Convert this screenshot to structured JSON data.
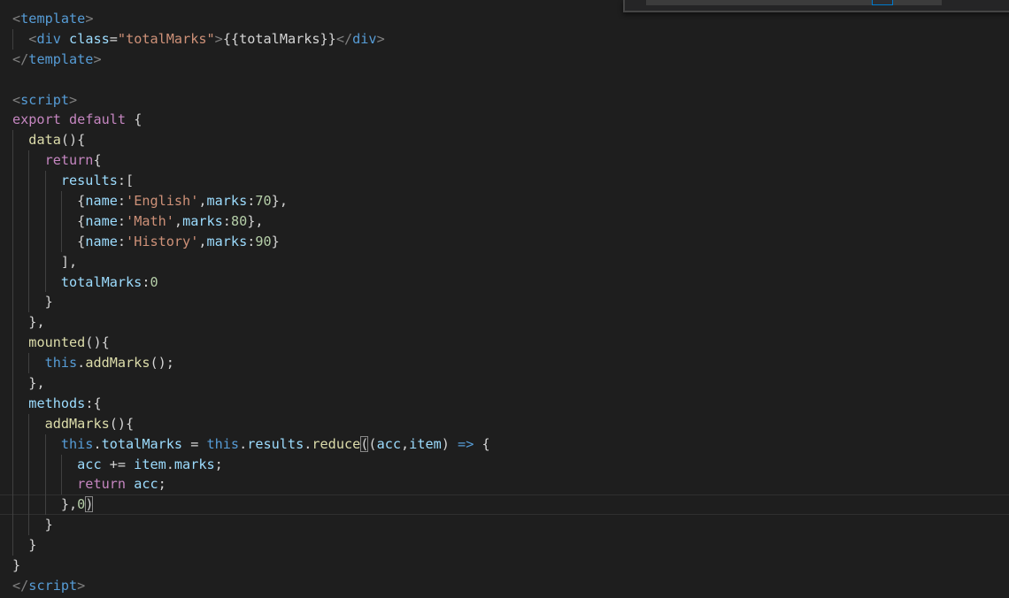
{
  "editor": {
    "lines": [
      {
        "indent": 0,
        "current": false,
        "tokens": [
          {
            "t": "<",
            "c": "bracket"
          },
          {
            "t": "template",
            "c": "tag"
          },
          {
            "t": ">",
            "c": "bracket"
          }
        ]
      },
      {
        "indent": 1,
        "current": false,
        "tokens": [
          {
            "t": "<",
            "c": "bracket"
          },
          {
            "t": "div",
            "c": "tag"
          },
          {
            "t": " ",
            "c": "plain"
          },
          {
            "t": "class",
            "c": "attr"
          },
          {
            "t": "=",
            "c": "plain"
          },
          {
            "t": "\"totalMarks\"",
            "c": "str"
          },
          {
            "t": ">",
            "c": "bracket"
          },
          {
            "t": "{{totalMarks}}",
            "c": "plain"
          },
          {
            "t": "</",
            "c": "bracket"
          },
          {
            "t": "div",
            "c": "tag"
          },
          {
            "t": ">",
            "c": "bracket"
          }
        ]
      },
      {
        "indent": 0,
        "current": false,
        "tokens": [
          {
            "t": "</",
            "c": "bracket"
          },
          {
            "t": "template",
            "c": "tag"
          },
          {
            "t": ">",
            "c": "bracket"
          }
        ]
      },
      {
        "indent": 0,
        "current": false,
        "tokens": []
      },
      {
        "indent": 0,
        "current": false,
        "tokens": [
          {
            "t": "<",
            "c": "bracket"
          },
          {
            "t": "script",
            "c": "tag"
          },
          {
            "t": ">",
            "c": "bracket"
          }
        ]
      },
      {
        "indent": 0,
        "current": false,
        "tokens": [
          {
            "t": "export",
            "c": "kw"
          },
          {
            "t": " ",
            "c": "plain"
          },
          {
            "t": "default",
            "c": "kw"
          },
          {
            "t": " {",
            "c": "plain"
          }
        ]
      },
      {
        "indent": 1,
        "current": false,
        "tokens": [
          {
            "t": "data",
            "c": "fn"
          },
          {
            "t": "(){",
            "c": "plain"
          }
        ]
      },
      {
        "indent": 2,
        "current": false,
        "tokens": [
          {
            "t": "return",
            "c": "kw"
          },
          {
            "t": "{",
            "c": "plain"
          }
        ]
      },
      {
        "indent": 3,
        "current": false,
        "tokens": [
          {
            "t": "results",
            "c": "prop"
          },
          {
            "t": ":[",
            "c": "plain"
          }
        ]
      },
      {
        "indent": 4,
        "current": false,
        "tokens": [
          {
            "t": "{",
            "c": "plain"
          },
          {
            "t": "name",
            "c": "prop"
          },
          {
            "t": ":",
            "c": "plain"
          },
          {
            "t": "'English'",
            "c": "str"
          },
          {
            "t": ",",
            "c": "plain"
          },
          {
            "t": "marks",
            "c": "prop"
          },
          {
            "t": ":",
            "c": "plain"
          },
          {
            "t": "70",
            "c": "num"
          },
          {
            "t": "},",
            "c": "plain"
          }
        ]
      },
      {
        "indent": 4,
        "current": false,
        "tokens": [
          {
            "t": "{",
            "c": "plain"
          },
          {
            "t": "name",
            "c": "prop"
          },
          {
            "t": ":",
            "c": "plain"
          },
          {
            "t": "'Math'",
            "c": "str"
          },
          {
            "t": ",",
            "c": "plain"
          },
          {
            "t": "marks",
            "c": "prop"
          },
          {
            "t": ":",
            "c": "plain"
          },
          {
            "t": "80",
            "c": "num"
          },
          {
            "t": "},",
            "c": "plain"
          }
        ]
      },
      {
        "indent": 4,
        "current": false,
        "tokens": [
          {
            "t": "{",
            "c": "plain"
          },
          {
            "t": "name",
            "c": "prop"
          },
          {
            "t": ":",
            "c": "plain"
          },
          {
            "t": "'History'",
            "c": "str"
          },
          {
            "t": ",",
            "c": "plain"
          },
          {
            "t": "marks",
            "c": "prop"
          },
          {
            "t": ":",
            "c": "plain"
          },
          {
            "t": "90",
            "c": "num"
          },
          {
            "t": "}",
            "c": "plain"
          }
        ]
      },
      {
        "indent": 3,
        "current": false,
        "tokens": [
          {
            "t": "],",
            "c": "plain"
          }
        ]
      },
      {
        "indent": 3,
        "current": false,
        "tokens": [
          {
            "t": "totalMarks",
            "c": "prop"
          },
          {
            "t": ":",
            "c": "plain"
          },
          {
            "t": "0",
            "c": "num"
          }
        ]
      },
      {
        "indent": 2,
        "current": false,
        "tokens": [
          {
            "t": "}",
            "c": "plain"
          }
        ]
      },
      {
        "indent": 1,
        "current": false,
        "tokens": [
          {
            "t": "},",
            "c": "plain"
          }
        ]
      },
      {
        "indent": 1,
        "current": false,
        "tokens": [
          {
            "t": "mounted",
            "c": "fn"
          },
          {
            "t": "(){",
            "c": "plain"
          }
        ]
      },
      {
        "indent": 2,
        "current": false,
        "tokens": [
          {
            "t": "this",
            "c": "this"
          },
          {
            "t": ".",
            "c": "plain"
          },
          {
            "t": "addMarks",
            "c": "fn"
          },
          {
            "t": "();",
            "c": "plain"
          }
        ]
      },
      {
        "indent": 1,
        "current": false,
        "tokens": [
          {
            "t": "},",
            "c": "plain"
          }
        ]
      },
      {
        "indent": 1,
        "current": false,
        "tokens": [
          {
            "t": "methods",
            "c": "prop"
          },
          {
            "t": ":{",
            "c": "plain"
          }
        ]
      },
      {
        "indent": 2,
        "current": false,
        "tokens": [
          {
            "t": "addMarks",
            "c": "fn"
          },
          {
            "t": "(){",
            "c": "plain"
          }
        ]
      },
      {
        "indent": 3,
        "current": false,
        "tokens": [
          {
            "t": "this",
            "c": "this"
          },
          {
            "t": ".",
            "c": "plain"
          },
          {
            "t": "totalMarks",
            "c": "prop"
          },
          {
            "t": " = ",
            "c": "plain"
          },
          {
            "t": "this",
            "c": "this"
          },
          {
            "t": ".",
            "c": "plain"
          },
          {
            "t": "results",
            "c": "prop"
          },
          {
            "t": ".",
            "c": "plain"
          },
          {
            "t": "reduce",
            "c": "fn"
          },
          {
            "t": "(",
            "c": "plain",
            "m": true
          },
          {
            "t": "(",
            "c": "plain"
          },
          {
            "t": "acc",
            "c": "prop"
          },
          {
            "t": ",",
            "c": "plain"
          },
          {
            "t": "item",
            "c": "prop"
          },
          {
            "t": ") ",
            "c": "plain"
          },
          {
            "t": "=>",
            "c": "arrow"
          },
          {
            "t": " {",
            "c": "plain"
          }
        ]
      },
      {
        "indent": 4,
        "current": false,
        "tokens": [
          {
            "t": "acc",
            "c": "prop"
          },
          {
            "t": " += ",
            "c": "plain"
          },
          {
            "t": "item",
            "c": "prop"
          },
          {
            "t": ".",
            "c": "plain"
          },
          {
            "t": "marks",
            "c": "prop"
          },
          {
            "t": ";",
            "c": "plain"
          }
        ]
      },
      {
        "indent": 4,
        "current": false,
        "tokens": [
          {
            "t": "return",
            "c": "kw"
          },
          {
            "t": " ",
            "c": "plain"
          },
          {
            "t": "acc",
            "c": "prop"
          },
          {
            "t": ";",
            "c": "plain"
          }
        ]
      },
      {
        "indent": 3,
        "current": true,
        "tokens": [
          {
            "t": "},",
            "c": "plain"
          },
          {
            "t": "0",
            "c": "num"
          },
          {
            "t": ")",
            "c": "plain",
            "m": true
          }
        ]
      },
      {
        "indent": 2,
        "current": false,
        "tokens": [
          {
            "t": "}",
            "c": "plain"
          }
        ]
      },
      {
        "indent": 1,
        "current": false,
        "tokens": [
          {
            "t": "}",
            "c": "plain"
          }
        ]
      },
      {
        "indent": 0,
        "current": false,
        "tokens": [
          {
            "t": "}",
            "c": "plain"
          }
        ]
      },
      {
        "indent": 0,
        "current": false,
        "tokens": [
          {
            "t": "</",
            "c": "bracket"
          },
          {
            "t": "script",
            "c": "tag"
          },
          {
            "t": ">",
            "c": "bracket"
          }
        ]
      }
    ]
  }
}
